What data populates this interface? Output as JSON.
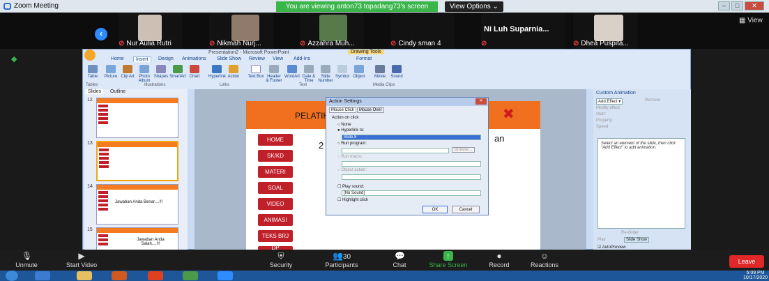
{
  "zoom": {
    "title": "Zoom Meeting",
    "viewing_banner": "You are viewing anton73 topadang73's screen",
    "view_options": "View Options ⌄",
    "view_label": "View",
    "participants": [
      {
        "name": "Nur Aulia Rutri"
      },
      {
        "name": "Nikmah Nurj..."
      },
      {
        "name": "Azzahra Muh..."
      },
      {
        "name": "Cindy sman 4"
      },
      {
        "name": "Ni Luh Suparnia..."
      },
      {
        "name": "Dhea Puspita..."
      }
    ],
    "toolbar": [
      {
        "label": "Unmute",
        "icon": "microphone-muted-icon"
      },
      {
        "label": "Start Video",
        "icon": "video-off-icon"
      },
      {
        "label": "Security",
        "icon": "shield-icon"
      },
      {
        "label": "Participants",
        "icon": "participants-icon",
        "count": "30"
      },
      {
        "label": "Chat",
        "icon": "chat-icon"
      },
      {
        "label": "Share Screen",
        "icon": "share-screen-icon"
      },
      {
        "label": "Record",
        "icon": "record-icon"
      },
      {
        "label": "Reactions",
        "icon": "reactions-icon"
      }
    ],
    "leave": "Leave",
    "colors": {
      "accent": "#2d8cff",
      "share": "#39b54a",
      "leave": "#e02828"
    }
  },
  "ppt": {
    "title": "Presentation2 - Microsoft PowerPoint",
    "drawing_tools": "Drawing Tools",
    "tabs": [
      "Home",
      "Insert",
      "Design",
      "Animations",
      "Slide Show",
      "Review",
      "View",
      "Add-Ins",
      "Format"
    ],
    "active_tab": "Insert",
    "ribbon_buttons": [
      "Table",
      "Picture",
      "Clip Art",
      "Photo Album",
      "Shapes",
      "SmartArt",
      "Chart",
      "Hyperlink",
      "Action",
      "Text Box",
      "Header & Footer",
      "WordArt",
      "Date & Time",
      "Slide Number",
      "Symbol",
      "Object",
      "Movie",
      "Sound"
    ],
    "ribbon_groups": [
      "Tables",
      "Illustrations",
      "Links",
      "Text",
      "Media Clips"
    ],
    "panel_tabs": [
      "Slides",
      "Outline"
    ],
    "thumbnails": [
      {
        "num": "12"
      },
      {
        "num": "13"
      },
      {
        "num": "14",
        "text": "Jawaban Anda Benar....!!!"
      },
      {
        "num": "15",
        "text": "Jawaban Anda Salah....!!!"
      }
    ],
    "slide": {
      "title": "PELATIHAN PEMBUATAN SLIDE",
      "menu": [
        "HOME",
        "SK/KD",
        "MATERI",
        "SOAL",
        "VIDEO",
        "ANIMASI",
        "TEKS BRJ",
        "DP"
      ],
      "partial_left": "2",
      "partial_right": "an"
    },
    "dialog": {
      "title": "Action Settings",
      "tabs": [
        "Mouse Click",
        "Mouse Over"
      ],
      "action_label": "Action on click",
      "options": [
        "None",
        "Hyperlink to:",
        "Run program:",
        "Run macro:",
        "Object action:"
      ],
      "hyperlink_value": "Slide 8",
      "browse": "Browse...",
      "play_sound": "Play sound:",
      "sound_value": "[No Sound]",
      "highlight": "Highlight click",
      "ok": "OK",
      "cancel": "Cancel"
    },
    "right_panel": {
      "title": "Custom Animation",
      "add_effect": "Add Effect ▾",
      "remove": "Remove",
      "modify": "Modify effect",
      "fields": [
        "Start:",
        "Property:",
        "Speed:"
      ],
      "hint": "Select an element of the slide, then click \"Add Effect\" to add animation.",
      "reorder": "Re-Order",
      "play": "Play",
      "slide_show": "Slide Show",
      "autopreview": "AutoPreview"
    }
  },
  "taskbar": {
    "time": "5:09 PM",
    "date": "10/17/2020"
  }
}
